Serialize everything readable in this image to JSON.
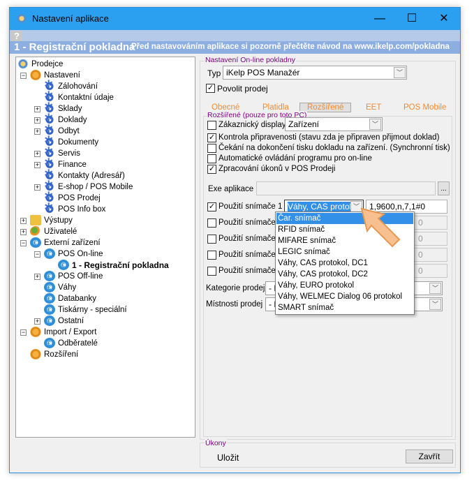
{
  "window": {
    "title": "Nastavení aplikace",
    "minimize": "—",
    "maximize": "☐",
    "close": "✕"
  },
  "help": "?",
  "header": {
    "title": "1 - Registrační pokladna",
    "note": "Před nastavováním aplikace si pozorně přečtěte návod na www.ikelp.com/pokladna"
  },
  "tree": [
    {
      "label": "Prodejce",
      "level": 0,
      "icon": "cloud"
    },
    {
      "label": "Nastavení",
      "level": 1,
      "icon": "ogear",
      "exp": "−"
    },
    {
      "label": "Zálohování",
      "level": 2,
      "icon": "gear"
    },
    {
      "label": "Kontaktní údaje",
      "level": 2,
      "icon": "gear"
    },
    {
      "label": "Sklady",
      "level": 2,
      "icon": "gear",
      "exp": "+"
    },
    {
      "label": "Doklady",
      "level": 2,
      "icon": "gear",
      "exp": "+"
    },
    {
      "label": "Odbyt",
      "level": 2,
      "icon": "gear",
      "exp": "+"
    },
    {
      "label": "Dokumenty",
      "level": 2,
      "icon": "gear"
    },
    {
      "label": "Servis",
      "level": 2,
      "icon": "gear",
      "exp": "+"
    },
    {
      "label": "Finance",
      "level": 2,
      "icon": "gear",
      "exp": "+"
    },
    {
      "label": "Kontakty (Adresář)",
      "level": 2,
      "icon": "gear"
    },
    {
      "label": "E-shop / POS Mobile",
      "level": 2,
      "icon": "gear",
      "exp": "+"
    },
    {
      "label": "POS Prodej",
      "level": 2,
      "icon": "gear"
    },
    {
      "label": "POS Info box",
      "level": 2,
      "icon": "gear"
    },
    {
      "label": "Výstupy",
      "level": 1,
      "icon": "fold",
      "exp": "+"
    },
    {
      "label": "Uživatelé",
      "level": 1,
      "icon": "user",
      "exp": "+"
    },
    {
      "label": "Externí zařízení",
      "level": 1,
      "icon": "euro",
      "exp": "−"
    },
    {
      "label": "POS On-line",
      "level": 2,
      "icon": "euro",
      "exp": "−"
    },
    {
      "label": "1 - Registrační pokladna",
      "level": 3,
      "icon": "euro",
      "selected": true
    },
    {
      "label": "POS Off-line",
      "level": 2,
      "icon": "euro",
      "exp": "+"
    },
    {
      "label": "Váhy",
      "level": 2,
      "icon": "euro"
    },
    {
      "label": "Databanky",
      "level": 2,
      "icon": "euro"
    },
    {
      "label": "Tiskárny - speciální",
      "level": 2,
      "icon": "euro"
    },
    {
      "label": "Ostatní",
      "level": 2,
      "icon": "euro",
      "exp": "+"
    },
    {
      "label": "Import / Export",
      "level": 1,
      "icon": "ogear",
      "exp": "−"
    },
    {
      "label": "Odběratelé",
      "level": 2,
      "icon": "euro"
    },
    {
      "label": "Rozšíření",
      "level": 1,
      "icon": "ogear"
    }
  ],
  "online": {
    "group": "Nastavení On-line pokladny",
    "typ_label": "Typ",
    "typ_value": "iKelp POS Manažér",
    "povolit": "Povolit prodej",
    "povolit_checked": true
  },
  "tabs": [
    "Obecné",
    "Platidla",
    "Rozšířené",
    "EET",
    "POS Mobile"
  ],
  "active_tab": "Rozšířené",
  "ext": {
    "group": "Rozšířené (pouze pro toto PC)",
    "display_label": "Zákaznický display",
    "display_value": "Zařízení",
    "checks": [
      {
        "label": "Kontrola připravenosti (stavu zda je připraven přijmout doklad)",
        "checked": true
      },
      {
        "label": "Čekání na dokončení tisku dokladu na zařízení. (Synchronní tisk)",
        "checked": false
      },
      {
        "label": "Automatické ovládání programu pro on-line",
        "checked": false
      },
      {
        "label": "Zpracování úkonů v POS Prodeji",
        "checked": true
      }
    ],
    "exe_label": "Exe aplikace",
    "exe_btn": "...",
    "scanners": [
      {
        "label": "Použití snímače 1",
        "checked": true,
        "value": "Váhy, CAS protok",
        "param": "1,9600,n,7,1#0"
      },
      {
        "label": "Použití snímače 2",
        "checked": false,
        "param": "0"
      },
      {
        "label": "Použití snímače 3",
        "checked": false,
        "param": "0"
      },
      {
        "label": "Použití snímače 4",
        "checked": false,
        "param": "0"
      },
      {
        "label": "Použití snímače 5",
        "checked": false,
        "param": "0"
      }
    ],
    "kategorie_label": "Kategorie prodej",
    "kategorie_value": "- N",
    "mistnosti_label": "Místnosti prodej",
    "mistnosti_value": "- N"
  },
  "dropdown": [
    "Čar. snímač",
    "RFID snímač",
    "MIFARE snímač",
    "LEGIC snímač",
    "Váhy, CAS protokol, DC1",
    "Váhy, CAS protokol, DC2",
    "Váhy, EURO protokol",
    "Váhy, WELMEC Dialog 06 protokol",
    "SMART snímač"
  ],
  "dropdown_highlight": "Čar. snímač",
  "ukony": {
    "group": "Úkony",
    "save": "Uložit",
    "close": "Zavřít"
  },
  "colors": {
    "titlebar": "#2ba0f0",
    "header": "#8daee0",
    "group_label": "#800080",
    "tab": "#f08a30",
    "highlight": "#3390e8",
    "arrow": "#f5b070"
  }
}
